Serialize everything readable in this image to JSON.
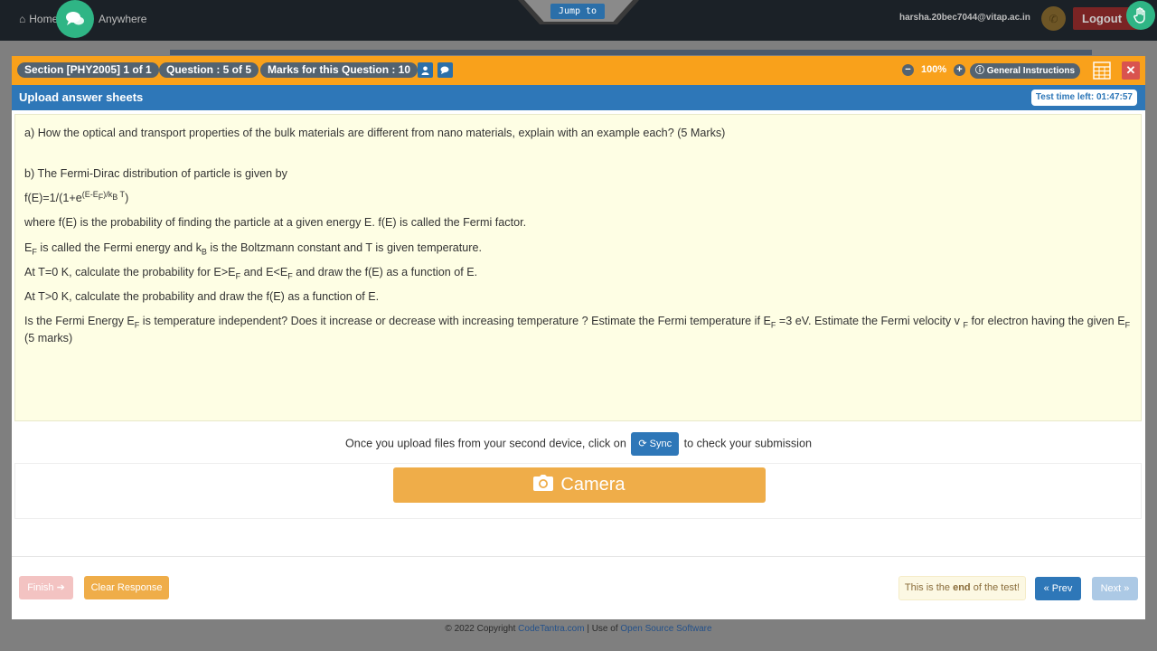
{
  "topnav": {
    "home_label": "Home",
    "anywhere_label": "Anywhere",
    "jump_label": "Jump to",
    "email": "harsha.20bec7044@vitap.ac.in",
    "logout_label": "Logout"
  },
  "header": {
    "section": "Section [PHY2005] 1 of 1",
    "question": "Question : 5 of 5",
    "marks": "Marks for this Question : 10",
    "zoom": "100%",
    "general_instructions": "General Instructions"
  },
  "subheader": {
    "title": "Upload answer sheets",
    "timer": "Test time left: 01:47:57"
  },
  "question": {
    "part_a": "a) How the optical and transport properties of the bulk materials are different from nano materials, explain with an example each? (5 Marks)",
    "part_b": "b) The Fermi-Dirac distribution of particle is given by",
    "fermi_factor": "where f(E) is the probability of finding the particle at a given energy E. f(E) is called the Fermi factor.",
    "at_t0": "At T=0 K, calculate the probability for E>E",
    "at_t_gt0": "At T>0 K, calculate the probability and draw the f(E) as a function of E."
  },
  "sync": {
    "prefix": "Once you upload files from your second device, click on",
    "button": "Sync",
    "suffix": "to check your submission"
  },
  "upload": {
    "camera_label": "Camera"
  },
  "footer_buttons": {
    "finish": "Finish",
    "clear": "Clear Response",
    "end_note_pre": "This is the",
    "end_note_bold": "end",
    "end_note_post": "of the test!",
    "prev": "Prev",
    "next": "Next"
  },
  "footer": {
    "copyright": "© 2022 Copyright",
    "site": "CodeTantra.com",
    "use_of": "| Use of",
    "oss": "Open Source Software"
  },
  "colors": {
    "header_orange": "#f9a11b",
    "subheader_blue": "#2e77b8",
    "camera_orange": "#efad49",
    "question_bg": "#fefee4"
  }
}
